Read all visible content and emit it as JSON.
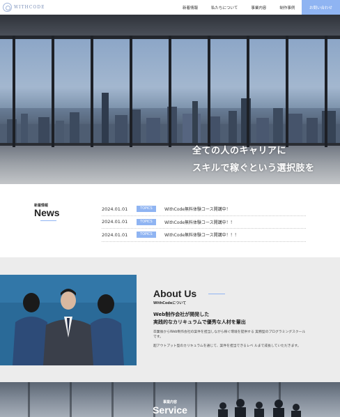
{
  "header": {
    "logo_text": "WITHCODE",
    "nav": [
      "新着情報",
      "私たちについて",
      "事業内容",
      "制作事例"
    ],
    "contact_label": "お問い合わせ"
  },
  "hero": {
    "line1": "全ての人のキャリアに",
    "line2": "スキルで稼ぐという選択肢を"
  },
  "news": {
    "label": "新着情報",
    "title": "News",
    "items": [
      {
        "date": "2024.01.01",
        "tag": "TOPICS",
        "text": "WithCode無料体験コース開講中！"
      },
      {
        "date": "2024.01.01",
        "tag": "TOPICS",
        "text": "WithCode無料体験コース開講中！！"
      },
      {
        "date": "2024.01.01",
        "tag": "TOPICS",
        "text": "WithCode無料体験コース開講中！！！"
      }
    ]
  },
  "about": {
    "title": "About Us",
    "subtitle": "WithCodeについて",
    "lead1": "Web制作会社が開発した",
    "lead2": "実践的なカリキュラムで優秀な人材を輩出",
    "body1": "卒業後からWeb制作会社の案件を担当しながら稼ぐ環境を提供する 実務型のプログラミングスクールです。",
    "body2": "超アウトプット型のカリキュラムを通じて、案件を担当できるレベ ルまで成長していただきます。"
  },
  "service": {
    "label": "事業内容",
    "title": "Service"
  },
  "colors": {
    "accent": "#8fb4f2",
    "about_bg": "#ececec"
  }
}
